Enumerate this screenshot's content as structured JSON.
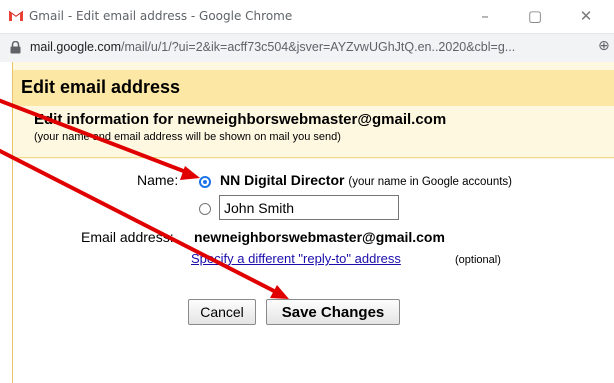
{
  "window": {
    "title": "Gmail - Edit email address - Google Chrome",
    "minimize_glyph": "–",
    "maximize_glyph": "▢",
    "close_glyph": "✕"
  },
  "address_bar": {
    "host": "mail.google.com",
    "path": "/mail/u/1/?ui=2&ik=acff73c504&jsver=AYZvwUGhJtQ.en..2020&cbl=g..."
  },
  "dialog": {
    "title": "Edit email address",
    "info_heading": "Edit information for newneighborswebmaster@gmail.com",
    "info_subtext": "(your name and email address will be shown on mail you send)",
    "name_label": "Name:",
    "option_google_name": "NN Digital Director",
    "option_google_hint": "(your name in Google accounts)",
    "custom_name_value": "John Smith",
    "email_label": "Email address:",
    "email_value": "newneighborswebmaster@gmail.com",
    "reply_to_link": "Specify a different \"reply-to\" address",
    "optional_text": "(optional)",
    "cancel_label": "Cancel",
    "save_label": "Save Changes",
    "selected_option": "google-name"
  },
  "colors": {
    "annotation_arrow": "#e00000",
    "dialog_header": "#fce8a4",
    "dialog_background": "#fff8e1",
    "link": "#1a0dab",
    "radio_selected": "#1a73e8"
  }
}
